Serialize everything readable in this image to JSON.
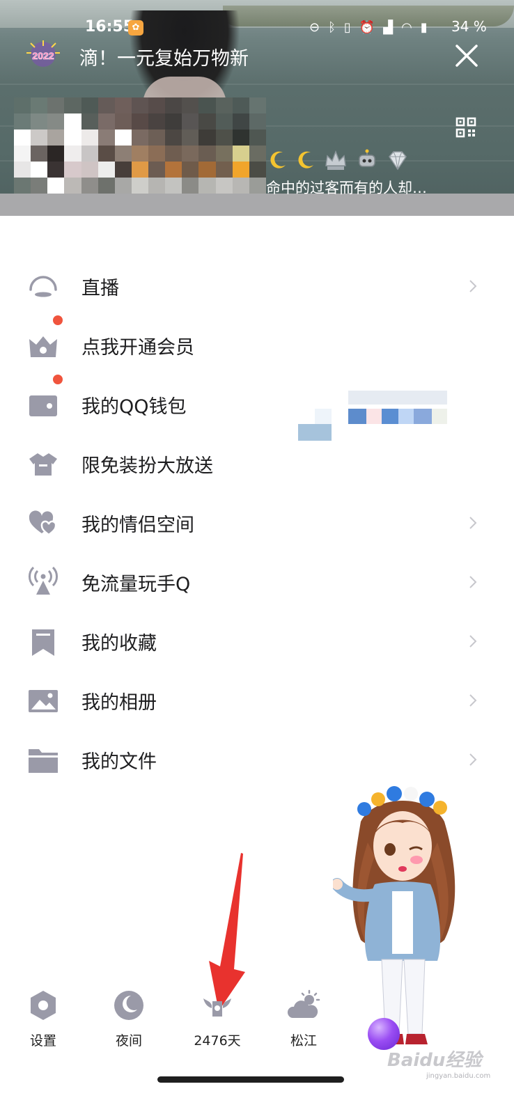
{
  "status_bar": {
    "time": "16:55",
    "battery_percent": "34 %",
    "icons": [
      "minus-circle-icon",
      "bluetooth-icon",
      "vibrate-icon",
      "alarm-icon",
      "hd-signal-icon",
      "wifi-icon",
      "battery-icon"
    ]
  },
  "header": {
    "badge_text": "2022",
    "promo_text": "滴！一元复始万物新",
    "signature": "命中的过客而有的人却…",
    "medals": [
      "moon-icon",
      "moon-icon",
      "crown-icon",
      "robot-icon",
      "diamond-icon"
    ]
  },
  "menu": {
    "items": [
      {
        "label": "直播",
        "icon": "live-icon"
      },
      {
        "label": "点我开通会员",
        "icon": "vip-icon"
      },
      {
        "label": "我的QQ钱包",
        "icon": "wallet-icon"
      },
      {
        "label": "限免装扮大放送",
        "icon": "tshirt-icon"
      },
      {
        "label": "我的情侣空间",
        "icon": "hearts-icon"
      },
      {
        "label": "免流量玩手Q",
        "icon": "antenna-icon"
      },
      {
        "label": "我的收藏",
        "icon": "bookmark-icon"
      },
      {
        "label": "我的相册",
        "icon": "image-icon"
      },
      {
        "label": "我的文件",
        "icon": "folder-icon"
      }
    ]
  },
  "bottom_bar": {
    "tabs": [
      {
        "label": "设置",
        "icon": "settings-hexagon-icon"
      },
      {
        "label": "夜间",
        "icon": "moon-icon"
      },
      {
        "label": "2476天",
        "icon": "winged-badge-icon"
      },
      {
        "label": "松江",
        "icon": "weather-cloud-sun-icon"
      }
    ]
  },
  "watermark": {
    "text": "Baidu经验",
    "sub": "jingyan.baidu.com"
  },
  "colors": {
    "icon_gray": "#9a9aa8",
    "text": "#1d1d1f",
    "notification_dot": "#f0543d",
    "arrow": "#e8322e"
  }
}
